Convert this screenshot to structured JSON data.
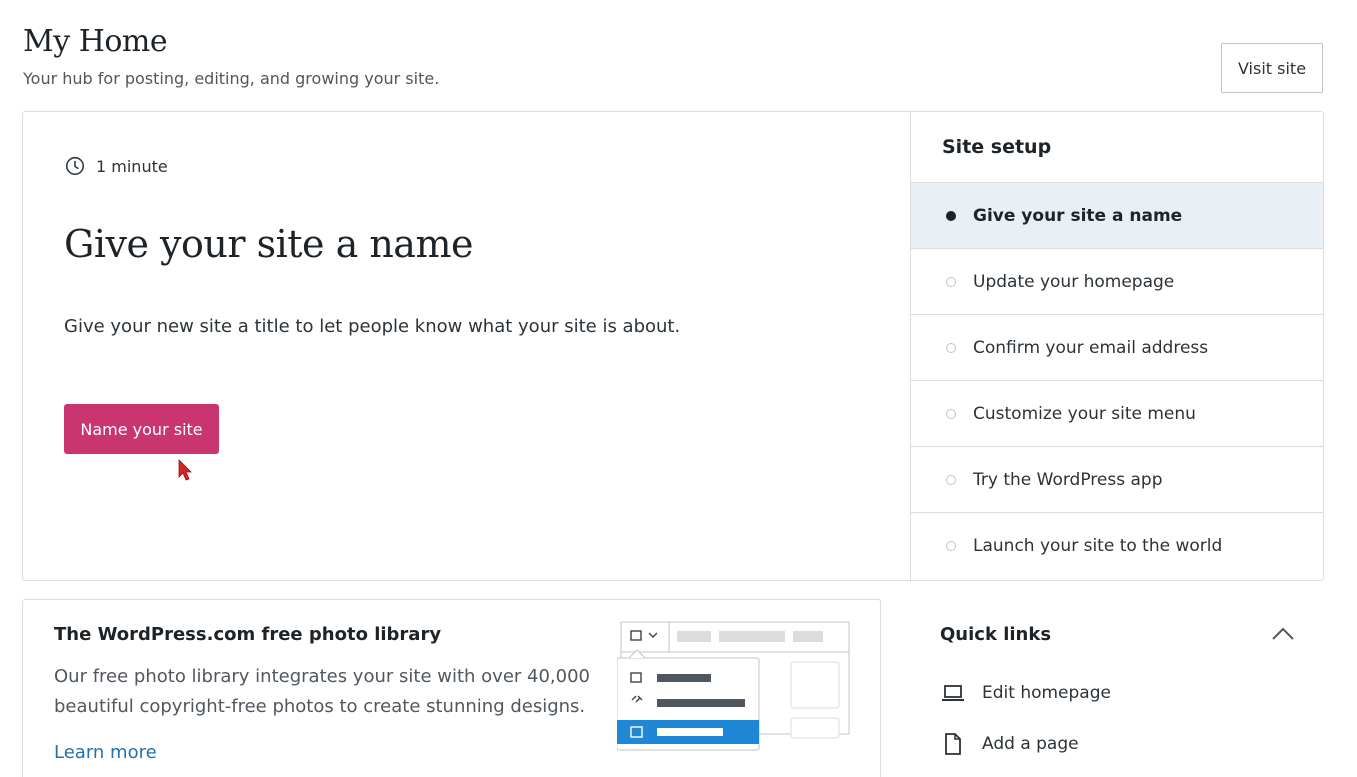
{
  "header": {
    "title": "My Home",
    "subtitle": "Your hub for posting, editing, and growing your site.",
    "visit_site_label": "Visit site"
  },
  "task": {
    "time": "1 minute",
    "title": "Give your site a name",
    "description": "Give your new site a title to let people know what your site is about.",
    "button_label": "Name your site"
  },
  "site_setup": {
    "heading": "Site setup",
    "items": [
      {
        "label": "Give your site a name",
        "active": true
      },
      {
        "label": "Update your homepage",
        "active": false
      },
      {
        "label": "Confirm your email address",
        "active": false
      },
      {
        "label": "Customize your site menu",
        "active": false
      },
      {
        "label": "Try the WordPress app",
        "active": false
      },
      {
        "label": "Launch your site to the world",
        "active": false
      }
    ]
  },
  "photo_library": {
    "title": "The WordPress.com free photo library",
    "description": "Our free photo library integrates your site with over 40,000 beautiful copyright-free photos to create stunning designs.",
    "learn_more": "Learn more"
  },
  "quick_links": {
    "title": "Quick links",
    "items": [
      {
        "label": "Edit homepage",
        "icon": "laptop-icon"
      },
      {
        "label": "Add a page",
        "icon": "page-icon"
      }
    ]
  },
  "colors": {
    "accent": "#c9356e",
    "link": "#2271b1",
    "active_row": "#e9eff5",
    "illustration_highlight": "#1e88d6"
  }
}
